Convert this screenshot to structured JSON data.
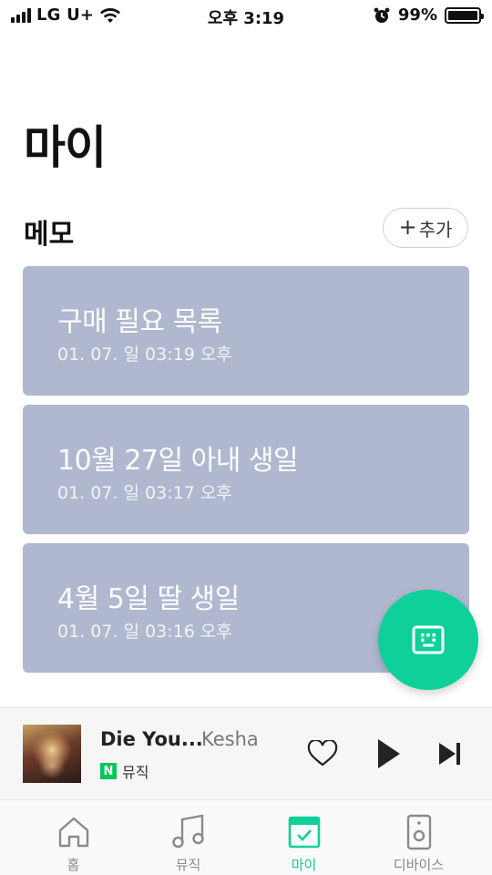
{
  "status_bar": {
    "carrier": "LG U+",
    "time": "오후 3:19",
    "battery_percent": "99%",
    "battery_level": 0.99,
    "icons": [
      "signal-icon",
      "wifi-icon",
      "alarm-icon",
      "battery-icon"
    ]
  },
  "page": {
    "title": "마이"
  },
  "memo_section": {
    "title": "메모",
    "add_label": "추가",
    "add_icon": "plus-icon",
    "card_color": "#b0b8cf",
    "items": [
      {
        "title": "구매 필요 목록",
        "date": "01. 07. 일 03:19 오후"
      },
      {
        "title": "10월 27일 아내 생일",
        "date": "01. 07. 일 03:17 오후"
      },
      {
        "title": "4월 5일 딸 생일",
        "date": "01. 07. 일 03:16 오후"
      }
    ]
  },
  "fab": {
    "icon": "keyboard-icon",
    "color": "#0fd098"
  },
  "player": {
    "song_title": "Die You...",
    "artist": "Kesha",
    "source_badge": "N",
    "source_label": "뮤직",
    "icons": [
      "album-art",
      "heart-icon",
      "play-icon",
      "skip-next-icon"
    ]
  },
  "tabbar": {
    "active_color": "#0fd098",
    "tabs": [
      {
        "label": "홈",
        "icon": "home-icon",
        "active": false
      },
      {
        "label": "뮤직",
        "icon": "music-note-icon",
        "active": false
      },
      {
        "label": "마이",
        "icon": "calendar-check-icon",
        "active": true
      },
      {
        "label": "디바이스",
        "icon": "speaker-icon",
        "active": false
      }
    ]
  }
}
